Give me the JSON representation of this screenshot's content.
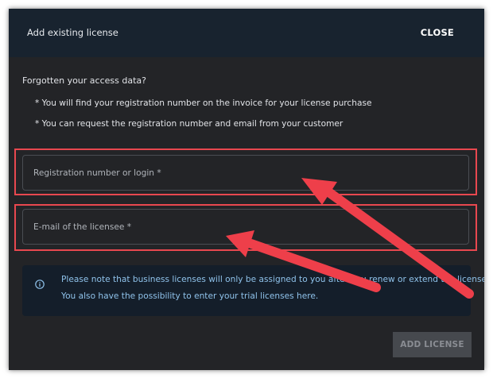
{
  "dialog": {
    "title": "Add existing license",
    "close_label": "CLOSE"
  },
  "help": {
    "question": "Forgotten your access data?",
    "hints": [
      "* You will find your registration number on the invoice for your license purchase",
      "* You can request the registration number and email from your customer"
    ]
  },
  "form": {
    "registration_placeholder": "Registration number or login *",
    "email_placeholder": "E-mail of the licensee *"
  },
  "info": {
    "icon": "info-icon",
    "line1": "Please note that business licenses will only be assigned to you after you renew or extend the license.",
    "line2": "You also have the possibility to enter your trial licenses here."
  },
  "actions": {
    "add_label": "ADD LICENSE"
  },
  "colors": {
    "header": "#18232f",
    "dialog_bg": "#232427",
    "highlight": "#e8484f",
    "info_text": "#8fc2ea"
  }
}
